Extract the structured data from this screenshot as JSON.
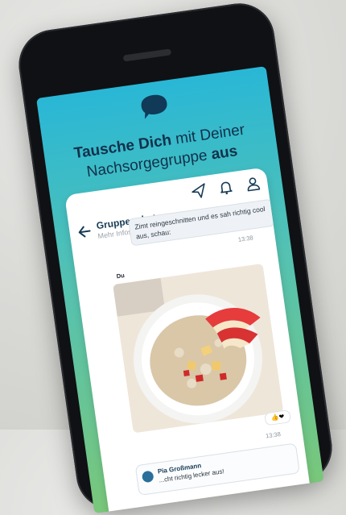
{
  "headline": {
    "part1": "Tausche Dich",
    "part2": " mit Deiner",
    "part3": "Nachsorgegruppe ",
    "part4": "aus"
  },
  "colors": {
    "screen_top": "#29b7d6",
    "screen_bottom": "#79c77a",
    "text_dark": "#11314a",
    "accent": "#163a55"
  },
  "icons": {
    "app": "chat-bubble-icon",
    "send": "send-icon",
    "bell": "bell-icon",
    "profile": "profile-icon",
    "back": "back-arrow-icon"
  },
  "chat": {
    "title": "Gruppenchat",
    "subtitle": "Mehr Infos",
    "incoming_text": "Zimt reingeschnitten und es sah richtig cool aus, schau:",
    "time1": "13:38",
    "sender_label": "Du",
    "reaction": "👍❤",
    "time2": "13:38",
    "reply_name": "Pia Großmann",
    "reply_text": "...cht richtig lecker aus!"
  }
}
